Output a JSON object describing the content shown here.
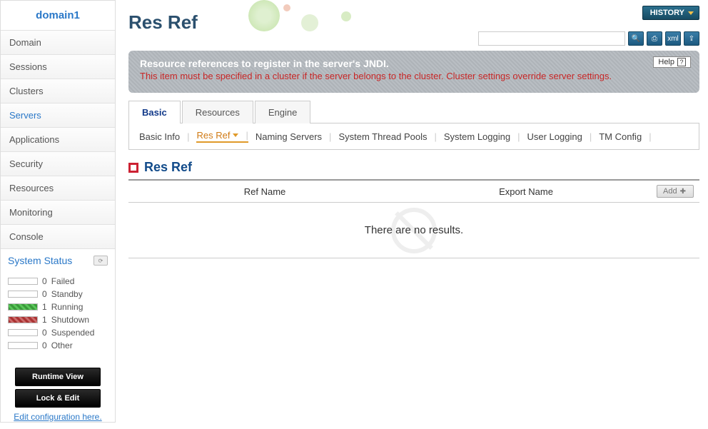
{
  "domain_title": "domain1",
  "nav": [
    {
      "label": "Domain"
    },
    {
      "label": "Sessions"
    },
    {
      "label": "Clusters"
    },
    {
      "label": "Servers",
      "active": true
    },
    {
      "label": "Applications"
    },
    {
      "label": "Security"
    },
    {
      "label": "Resources"
    },
    {
      "label": "Monitoring"
    },
    {
      "label": "Console"
    }
  ],
  "system_status": {
    "title": "System Status",
    "items": [
      {
        "count": "0",
        "label": "Failed",
        "swatch": ""
      },
      {
        "count": "0",
        "label": "Standby",
        "swatch": ""
      },
      {
        "count": "1",
        "label": "Running",
        "swatch": "running"
      },
      {
        "count": "1",
        "label": "Shutdown",
        "swatch": "shutdown"
      },
      {
        "count": "0",
        "label": "Suspended",
        "swatch": ""
      },
      {
        "count": "0",
        "label": "Other",
        "swatch": ""
      }
    ]
  },
  "buttons": {
    "runtime_view": "Runtime View",
    "lock_edit": "Lock & Edit",
    "edit_link": "Edit configuration here."
  },
  "header": {
    "page_title": "Res Ref",
    "history_btn": "HISTORY",
    "search_placeholder": ""
  },
  "info_panel": {
    "title": "Resource references to register in the server's JNDI.",
    "warning": "This item must be specified in a cluster if the server belongs to the cluster. Cluster settings override server settings.",
    "help_label": "Help"
  },
  "tabs1": [
    {
      "label": "Basic",
      "active": true
    },
    {
      "label": "Resources"
    },
    {
      "label": "Engine"
    }
  ],
  "tabs2": [
    {
      "label": "Basic Info"
    },
    {
      "label": "Res Ref",
      "active": true
    },
    {
      "label": "Naming Servers"
    },
    {
      "label": "System Thread Pools"
    },
    {
      "label": "System Logging"
    },
    {
      "label": "User Logging"
    },
    {
      "label": "TM Config"
    }
  ],
  "section": {
    "title": "Res Ref",
    "col_ref": "Ref Name",
    "col_export": "Export Name",
    "add_label": "Add",
    "no_results": "There are no results."
  }
}
